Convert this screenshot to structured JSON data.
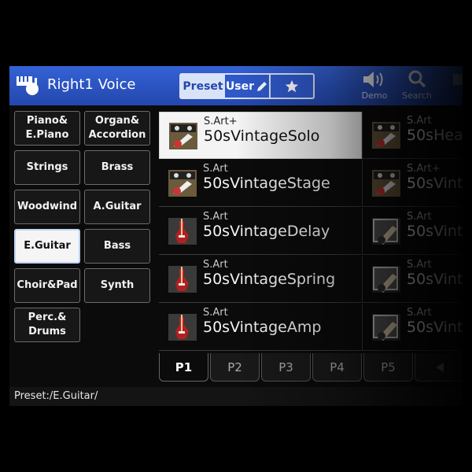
{
  "header": {
    "title": "Right1 Voice",
    "tabs": {
      "preset": "Preset",
      "user": "User"
    },
    "demo_label": "Demo",
    "search_label": "Search"
  },
  "categories": [
    "Piano&\nE.Piano",
    "Organ&\nAccordion",
    "Strings",
    "Brass",
    "Woodwind",
    "A.Guitar",
    "E.Guitar",
    "Bass",
    "Choir&Pad",
    "Synth",
    "Perc.&\nDrums"
  ],
  "selected_category": "E.Guitar",
  "voices_col1": [
    {
      "type": "S.Art+",
      "name": "50sVintageSolo",
      "icon": "sart-guitar-icon"
    },
    {
      "type": "S.Art",
      "name": "50sVintageStage",
      "icon": "sart-guitar-icon"
    },
    {
      "type": "S.Art",
      "name": "50sVintageDelay",
      "icon": "red-guitar-icon"
    },
    {
      "type": "S.Art",
      "name": "50sVintageSpring",
      "icon": "red-guitar-icon"
    },
    {
      "type": "S.Art",
      "name": "50sVintageAmp",
      "icon": "red-guitar-icon"
    }
  ],
  "voices_col2": [
    {
      "type": "S.Art",
      "name": "50sHea",
      "icon": "sart-guitar-icon"
    },
    {
      "type": "S.Art+",
      "name": "50sVint",
      "icon": "sart-guitar-icon"
    },
    {
      "type": "S.Art",
      "name": "50sVint",
      "icon": "amp-guitar-icon"
    },
    {
      "type": "S.Art",
      "name": "50sVint",
      "icon": "amp-guitar-icon"
    },
    {
      "type": "S.Art",
      "name": "50sVint",
      "icon": "amp-guitar-icon"
    }
  ],
  "pages": [
    "P1",
    "P2",
    "P3",
    "P4",
    "P5"
  ],
  "active_page": "P1",
  "path": "Preset:/E.Guitar/",
  "colors": {
    "header": "#2c55c4",
    "selected": "#f4f4f4",
    "panel": "#0b0b0b"
  }
}
